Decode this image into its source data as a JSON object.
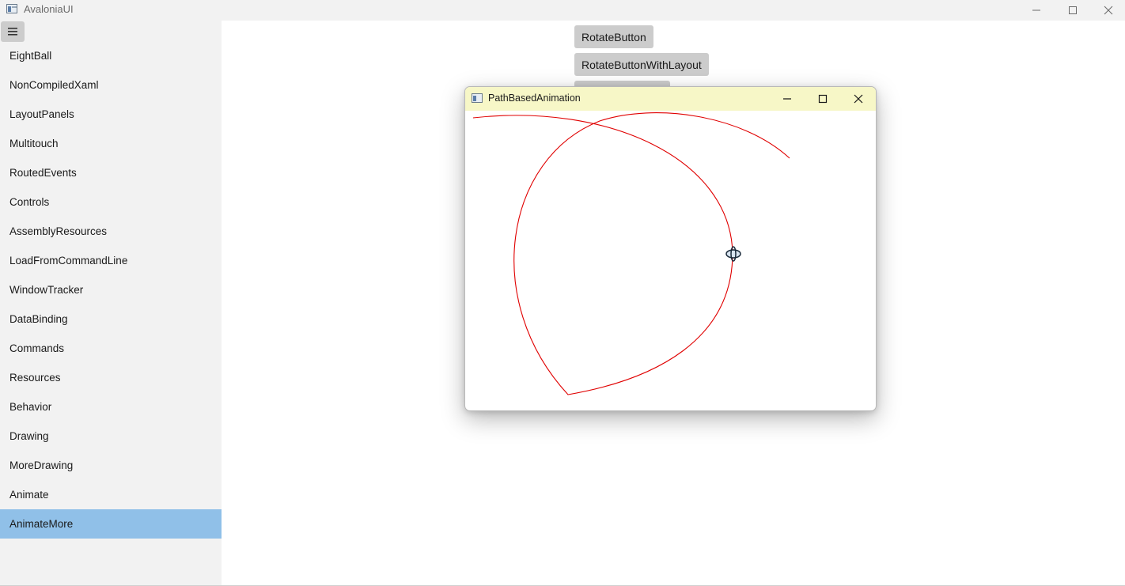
{
  "window": {
    "title": "AvaloniaUI"
  },
  "sidebar": {
    "items": [
      {
        "label": "EightBall"
      },
      {
        "label": "NonCompiledXaml"
      },
      {
        "label": "LayoutPanels"
      },
      {
        "label": "Multitouch"
      },
      {
        "label": "RoutedEvents"
      },
      {
        "label": "Controls"
      },
      {
        "label": "AssemblyResources"
      },
      {
        "label": "LoadFromCommandLine"
      },
      {
        "label": "WindowTracker"
      },
      {
        "label": "DataBinding"
      },
      {
        "label": "Commands"
      },
      {
        "label": "Resources"
      },
      {
        "label": "Behavior"
      },
      {
        "label": "Drawing"
      },
      {
        "label": "MoreDrawing"
      },
      {
        "label": "Animate"
      },
      {
        "label": "AnimateMore"
      }
    ],
    "selected": "AnimateMore"
  },
  "content": {
    "buttons": [
      {
        "label": "RotateButton"
      },
      {
        "label": "RotateButtonWithLayout"
      }
    ]
  },
  "child_window": {
    "title": "PathBasedAnimation",
    "path_color": "#e00000",
    "marker_icon": "rotating-ellipse-marker"
  },
  "colors": {
    "selected_item": "#90c0e8",
    "sidebar_bg": "#f2f2f2",
    "child_titlebar": "#f7f7c7",
    "button_bg": "#cccccc"
  }
}
